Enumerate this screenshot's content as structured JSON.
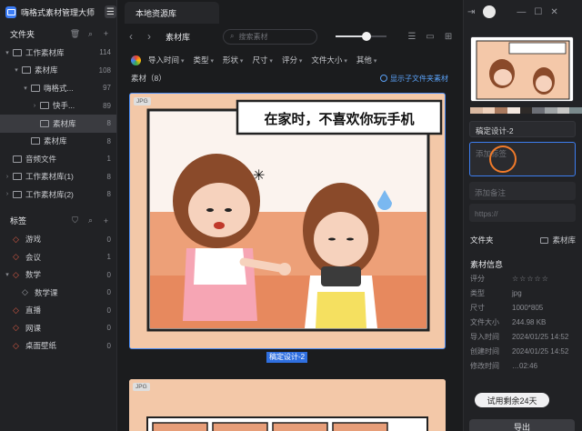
{
  "app": {
    "name": "嗨格式素材管理大师"
  },
  "sidebar": {
    "folders_title": "文件夹",
    "tree": [
      {
        "label": "工作素材库",
        "count": "114",
        "indent": 0,
        "arrow": "▾",
        "selected": false
      },
      {
        "label": "素材库",
        "count": "108",
        "indent": 1,
        "arrow": "▾",
        "selected": false
      },
      {
        "label": "嗨格式...",
        "count": "97",
        "indent": 2,
        "arrow": "▾",
        "selected": false
      },
      {
        "label": "快手...",
        "count": "89",
        "indent": 3,
        "arrow": "›",
        "selected": false
      },
      {
        "label": "素材库",
        "count": "8",
        "indent": 3,
        "arrow": "",
        "selected": true
      },
      {
        "label": "素材库",
        "count": "8",
        "indent": 2,
        "arrow": "",
        "selected": false
      },
      {
        "label": "音频文件",
        "count": "1",
        "indent": 0,
        "arrow": "",
        "selected": false
      },
      {
        "label": "工作素材库(1)",
        "count": "8",
        "indent": 0,
        "arrow": "›",
        "selected": false
      },
      {
        "label": "工作素材库(2)",
        "count": "8",
        "indent": 0,
        "arrow": "›",
        "selected": false
      }
    ],
    "tags_title": "标签",
    "tags": [
      {
        "label": "游戏",
        "count": "0",
        "indent": 0,
        "arrow": "",
        "gray": false
      },
      {
        "label": "会议",
        "count": "1",
        "indent": 0,
        "arrow": "",
        "gray": false
      },
      {
        "label": "数学",
        "count": "0",
        "indent": 0,
        "arrow": "▾",
        "gray": false
      },
      {
        "label": "数学课",
        "count": "0",
        "indent": 1,
        "arrow": "",
        "gray": true
      },
      {
        "label": "直播",
        "count": "0",
        "indent": 0,
        "arrow": "",
        "gray": false
      },
      {
        "label": "网课",
        "count": "0",
        "indent": 0,
        "arrow": "",
        "gray": false
      },
      {
        "label": "桌面壁纸",
        "count": "0",
        "indent": 0,
        "arrow": "",
        "gray": false
      }
    ]
  },
  "main": {
    "tab": "本地资源库",
    "breadcrumb": "素材库",
    "search_placeholder": "搜索素材",
    "zoom": 0.6,
    "filters": [
      "导入时间",
      "类型",
      "形状",
      "尺寸",
      "评分",
      "文件大小",
      "其他"
    ],
    "asset_count_label": "素材（8）",
    "show_subfolder": "显示子文件夹素材",
    "card": {
      "badge": "JPG",
      "filename": "稿定设计-2",
      "comic_text": "在家时，不喜欢你玩手机"
    },
    "card2": {
      "badge": "JPG"
    }
  },
  "right": {
    "palette": [
      "#d9b8a1",
      "#efd2bd",
      "#a8795e",
      "#f3e7de",
      "#2e2a28",
      "#6c6f76",
      "#9fa4a6",
      "#c7c7c5",
      "#7a8a8c"
    ],
    "name_value": "稿定设计-2",
    "tag_placeholder": "添加标签",
    "note_placeholder": "添加备注",
    "url_placeholder": "https://",
    "folder_label": "文件夹",
    "folder_value": "素材库",
    "info_title": "素材信息",
    "info": [
      {
        "k": "评分",
        "v": "☆☆☆☆☆"
      },
      {
        "k": "类型",
        "v": "jpg"
      },
      {
        "k": "尺寸",
        "v": "1000*805"
      },
      {
        "k": "文件大小",
        "v": "244.98 KB"
      },
      {
        "k": "导入时间",
        "v": "2024/01/25 14:52"
      },
      {
        "k": "创建时间",
        "v": "2024/01/25 14:52"
      },
      {
        "k": "修改时间",
        "v": "…02:46"
      }
    ],
    "trial": "试用剩余24天",
    "export": "导出"
  }
}
